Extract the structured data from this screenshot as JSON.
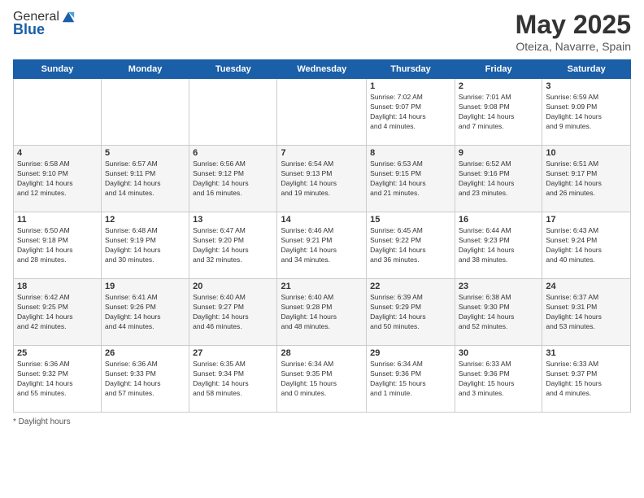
{
  "logo": {
    "general": "General",
    "blue": "Blue"
  },
  "header": {
    "month": "May 2025",
    "location": "Oteiza, Navarre, Spain"
  },
  "days_of_week": [
    "Sunday",
    "Monday",
    "Tuesday",
    "Wednesday",
    "Thursday",
    "Friday",
    "Saturday"
  ],
  "footer": {
    "daylight_label": "Daylight hours"
  },
  "weeks": [
    [
      {
        "day": "",
        "info": ""
      },
      {
        "day": "",
        "info": ""
      },
      {
        "day": "",
        "info": ""
      },
      {
        "day": "",
        "info": ""
      },
      {
        "day": "1",
        "info": "Sunrise: 7:02 AM\nSunset: 9:07 PM\nDaylight: 14 hours\nand 4 minutes."
      },
      {
        "day": "2",
        "info": "Sunrise: 7:01 AM\nSunset: 9:08 PM\nDaylight: 14 hours\nand 7 minutes."
      },
      {
        "day": "3",
        "info": "Sunrise: 6:59 AM\nSunset: 9:09 PM\nDaylight: 14 hours\nand 9 minutes."
      }
    ],
    [
      {
        "day": "4",
        "info": "Sunrise: 6:58 AM\nSunset: 9:10 PM\nDaylight: 14 hours\nand 12 minutes."
      },
      {
        "day": "5",
        "info": "Sunrise: 6:57 AM\nSunset: 9:11 PM\nDaylight: 14 hours\nand 14 minutes."
      },
      {
        "day": "6",
        "info": "Sunrise: 6:56 AM\nSunset: 9:12 PM\nDaylight: 14 hours\nand 16 minutes."
      },
      {
        "day": "7",
        "info": "Sunrise: 6:54 AM\nSunset: 9:13 PM\nDaylight: 14 hours\nand 19 minutes."
      },
      {
        "day": "8",
        "info": "Sunrise: 6:53 AM\nSunset: 9:15 PM\nDaylight: 14 hours\nand 21 minutes."
      },
      {
        "day": "9",
        "info": "Sunrise: 6:52 AM\nSunset: 9:16 PM\nDaylight: 14 hours\nand 23 minutes."
      },
      {
        "day": "10",
        "info": "Sunrise: 6:51 AM\nSunset: 9:17 PM\nDaylight: 14 hours\nand 26 minutes."
      }
    ],
    [
      {
        "day": "11",
        "info": "Sunrise: 6:50 AM\nSunset: 9:18 PM\nDaylight: 14 hours\nand 28 minutes."
      },
      {
        "day": "12",
        "info": "Sunrise: 6:48 AM\nSunset: 9:19 PM\nDaylight: 14 hours\nand 30 minutes."
      },
      {
        "day": "13",
        "info": "Sunrise: 6:47 AM\nSunset: 9:20 PM\nDaylight: 14 hours\nand 32 minutes."
      },
      {
        "day": "14",
        "info": "Sunrise: 6:46 AM\nSunset: 9:21 PM\nDaylight: 14 hours\nand 34 minutes."
      },
      {
        "day": "15",
        "info": "Sunrise: 6:45 AM\nSunset: 9:22 PM\nDaylight: 14 hours\nand 36 minutes."
      },
      {
        "day": "16",
        "info": "Sunrise: 6:44 AM\nSunset: 9:23 PM\nDaylight: 14 hours\nand 38 minutes."
      },
      {
        "day": "17",
        "info": "Sunrise: 6:43 AM\nSunset: 9:24 PM\nDaylight: 14 hours\nand 40 minutes."
      }
    ],
    [
      {
        "day": "18",
        "info": "Sunrise: 6:42 AM\nSunset: 9:25 PM\nDaylight: 14 hours\nand 42 minutes."
      },
      {
        "day": "19",
        "info": "Sunrise: 6:41 AM\nSunset: 9:26 PM\nDaylight: 14 hours\nand 44 minutes."
      },
      {
        "day": "20",
        "info": "Sunrise: 6:40 AM\nSunset: 9:27 PM\nDaylight: 14 hours\nand 46 minutes."
      },
      {
        "day": "21",
        "info": "Sunrise: 6:40 AM\nSunset: 9:28 PM\nDaylight: 14 hours\nand 48 minutes."
      },
      {
        "day": "22",
        "info": "Sunrise: 6:39 AM\nSunset: 9:29 PM\nDaylight: 14 hours\nand 50 minutes."
      },
      {
        "day": "23",
        "info": "Sunrise: 6:38 AM\nSunset: 9:30 PM\nDaylight: 14 hours\nand 52 minutes."
      },
      {
        "day": "24",
        "info": "Sunrise: 6:37 AM\nSunset: 9:31 PM\nDaylight: 14 hours\nand 53 minutes."
      }
    ],
    [
      {
        "day": "25",
        "info": "Sunrise: 6:36 AM\nSunset: 9:32 PM\nDaylight: 14 hours\nand 55 minutes."
      },
      {
        "day": "26",
        "info": "Sunrise: 6:36 AM\nSunset: 9:33 PM\nDaylight: 14 hours\nand 57 minutes."
      },
      {
        "day": "27",
        "info": "Sunrise: 6:35 AM\nSunset: 9:34 PM\nDaylight: 14 hours\nand 58 minutes."
      },
      {
        "day": "28",
        "info": "Sunrise: 6:34 AM\nSunset: 9:35 PM\nDaylight: 15 hours\nand 0 minutes."
      },
      {
        "day": "29",
        "info": "Sunrise: 6:34 AM\nSunset: 9:36 PM\nDaylight: 15 hours\nand 1 minute."
      },
      {
        "day": "30",
        "info": "Sunrise: 6:33 AM\nSunset: 9:36 PM\nDaylight: 15 hours\nand 3 minutes."
      },
      {
        "day": "31",
        "info": "Sunrise: 6:33 AM\nSunset: 9:37 PM\nDaylight: 15 hours\nand 4 minutes."
      }
    ]
  ]
}
